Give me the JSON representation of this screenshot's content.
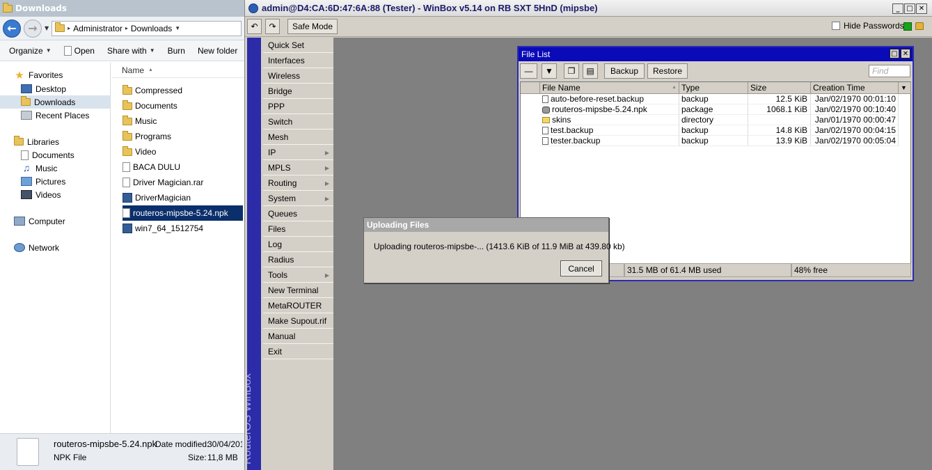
{
  "explorer": {
    "title": "Downloads",
    "address": {
      "segments": [
        "Administrator",
        "Downloads"
      ]
    },
    "toolbar": {
      "organize": "Organize",
      "open": "Open",
      "share_with": "Share with",
      "burn": "Burn",
      "new_folder": "New folder"
    },
    "nav": {
      "favorites": "Favorites",
      "desktop": "Desktop",
      "downloads": "Downloads",
      "recent_places": "Recent Places",
      "libraries": "Libraries",
      "documents": "Documents",
      "music": "Music",
      "pictures": "Pictures",
      "videos": "Videos",
      "computer": "Computer",
      "network": "Network"
    },
    "column_header": "Name",
    "files": [
      {
        "name": "Compressed",
        "kind": "folder"
      },
      {
        "name": "Documents",
        "kind": "folder"
      },
      {
        "name": "Music",
        "kind": "folder"
      },
      {
        "name": "Programs",
        "kind": "folder"
      },
      {
        "name": "Video",
        "kind": "folder"
      },
      {
        "name": "BACA DULU",
        "kind": "file"
      },
      {
        "name": "Driver Magician.rar",
        "kind": "file"
      },
      {
        "name": "DriverMagician",
        "kind": "app"
      },
      {
        "name": "routeros-mipsbe-5.24.npk",
        "kind": "file",
        "selected": true
      },
      {
        "name": "win7_64_1512754",
        "kind": "app"
      }
    ],
    "details": {
      "filename": "routeros-mipsbe-5.24.npk",
      "date_label": "Date modified:",
      "date_value": "30/04/201",
      "type": "NPK File",
      "size_label": "Size:",
      "size_value": "11,8 MB"
    }
  },
  "winbox": {
    "title": "admin@D4:CA:6D:47:6A:88 (Tester) - WinBox v5.14 on RB SXT 5HnD (mipsbe)",
    "safe_mode": "Safe Mode",
    "hide_passwords": "Hide Passwords",
    "side_label": "RouterOS WinBox",
    "menu": [
      {
        "label": "Quick Set"
      },
      {
        "label": "Interfaces"
      },
      {
        "label": "Wireless"
      },
      {
        "label": "Bridge"
      },
      {
        "label": "PPP"
      },
      {
        "label": "Switch"
      },
      {
        "label": "Mesh"
      },
      {
        "label": "IP",
        "sub": true
      },
      {
        "label": "MPLS",
        "sub": true
      },
      {
        "label": "Routing",
        "sub": true
      },
      {
        "label": "System",
        "sub": true
      },
      {
        "label": "Queues"
      },
      {
        "label": "Files"
      },
      {
        "label": "Log"
      },
      {
        "label": "Radius"
      },
      {
        "label": "Tools",
        "sub": true
      },
      {
        "label": "New Terminal"
      },
      {
        "label": "MetaROUTER"
      },
      {
        "label": "Make Supout.rif"
      },
      {
        "label": "Manual"
      },
      {
        "label": "Exit"
      }
    ]
  },
  "file_list": {
    "title": "File List",
    "backup": "Backup",
    "restore": "Restore",
    "find_placeholder": "Find",
    "columns": [
      "File Name",
      "Type",
      "Size",
      "Creation Time"
    ],
    "rows": [
      {
        "name": "auto-before-reset.backup",
        "type": "backup",
        "size": "12.5 KiB",
        "time": "Jan/02/1970 00:01:10",
        "icon": "doc"
      },
      {
        "name": "routeros-mipsbe-5.24.npk",
        "type": "package",
        "size": "1068.1 KiB",
        "time": "Jan/02/1970 00:10:40",
        "icon": "pkg"
      },
      {
        "name": "skins",
        "type": "directory",
        "size": "",
        "time": "Jan/01/1970 00:00:47",
        "icon": "dir"
      },
      {
        "name": "test.backup",
        "type": "backup",
        "size": "14.8 KiB",
        "time": "Jan/02/1970 00:04:15",
        "icon": "doc"
      },
      {
        "name": "tester.backup",
        "type": "backup",
        "size": "13.9 KiB",
        "time": "Jan/02/1970 00:05:04",
        "icon": "doc"
      }
    ],
    "status_used": "31.5 MB of 61.4 MB used",
    "status_free": "48% free"
  },
  "upload_dialog": {
    "title": "Uploading Files",
    "message": "Uploading routeros-mipsbe-... (1413.6 KiB of 11.9 MiB at 439.80 kb)",
    "cancel": "Cancel"
  }
}
